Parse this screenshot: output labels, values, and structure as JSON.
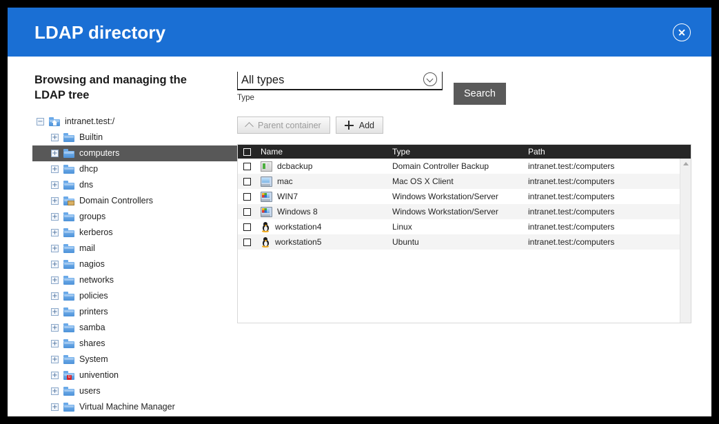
{
  "window": {
    "title": "LDAP directory",
    "close_icon": "close-circle-icon"
  },
  "sidebar": {
    "heading": "Browsing and managing the LDAP tree",
    "tree": {
      "root": {
        "label": "intranet.test:/",
        "toggle": "−",
        "icon": "home-folder-icon"
      },
      "items": [
        {
          "label": "Builtin",
          "toggle": "+",
          "icon": "folder-icon",
          "selected": false
        },
        {
          "label": "computers",
          "toggle": "+",
          "icon": "folder-icon",
          "selected": true
        },
        {
          "label": "dhcp",
          "toggle": "+",
          "icon": "folder-icon",
          "selected": false
        },
        {
          "label": "dns",
          "toggle": "+",
          "icon": "folder-icon",
          "selected": false
        },
        {
          "label": "Domain Controllers",
          "toggle": "+",
          "icon": "folder-box-icon",
          "selected": false
        },
        {
          "label": "groups",
          "toggle": "+",
          "icon": "folder-icon",
          "selected": false
        },
        {
          "label": "kerberos",
          "toggle": "+",
          "icon": "folder-icon",
          "selected": false
        },
        {
          "label": "mail",
          "toggle": "+",
          "icon": "folder-icon",
          "selected": false
        },
        {
          "label": "nagios",
          "toggle": "+",
          "icon": "folder-icon",
          "selected": false
        },
        {
          "label": "networks",
          "toggle": "+",
          "icon": "folder-icon",
          "selected": false
        },
        {
          "label": "policies",
          "toggle": "+",
          "icon": "folder-icon",
          "selected": false
        },
        {
          "label": "printers",
          "toggle": "+",
          "icon": "folder-icon",
          "selected": false
        },
        {
          "label": "samba",
          "toggle": "+",
          "icon": "folder-icon",
          "selected": false
        },
        {
          "label": "shares",
          "toggle": "+",
          "icon": "folder-icon",
          "selected": false
        },
        {
          "label": "System",
          "toggle": "+",
          "icon": "folder-icon",
          "selected": false
        },
        {
          "label": "univention",
          "toggle": "+",
          "icon": "folder-badge-icon",
          "selected": false
        },
        {
          "label": "users",
          "toggle": "+",
          "icon": "folder-icon",
          "selected": false
        },
        {
          "label": "Virtual Machine Manager",
          "toggle": "+",
          "icon": "folder-icon",
          "selected": false
        }
      ]
    }
  },
  "main": {
    "type_select": {
      "value": "All types",
      "label": "Type",
      "chevron_icon": "chevron-down-circle-icon"
    },
    "search_button": "Search",
    "parent_container_button": "Parent container",
    "add_button": "Add",
    "table": {
      "columns": [
        "Name",
        "Type",
        "Path"
      ],
      "rows": [
        {
          "name": "dcbackup",
          "type": "Domain Controller Backup",
          "path": "intranet.test:/computers",
          "icon": "server-icon"
        },
        {
          "name": "mac",
          "type": "Mac OS X Client",
          "path": "intranet.test:/computers",
          "icon": "mac-monitor-icon"
        },
        {
          "name": "WIN7",
          "type": "Windows Workstation/Server",
          "path": "intranet.test:/computers",
          "icon": "windows-monitor-icon"
        },
        {
          "name": "Windows 8",
          "type": "Windows Workstation/Server",
          "path": "intranet.test:/computers",
          "icon": "windows-monitor-icon"
        },
        {
          "name": "workstation4",
          "type": "Linux",
          "path": "intranet.test:/computers",
          "icon": "tux-icon"
        },
        {
          "name": "workstation5",
          "type": "Ubuntu",
          "path": "intranet.test:/computers",
          "icon": "tux-icon"
        }
      ]
    }
  },
  "colors": {
    "header_blue": "#1a6fd4",
    "table_header": "#262626",
    "selected_tree_row": "#585858",
    "search_button": "#5a5a5a",
    "row_alt": "#f4f4f4"
  }
}
